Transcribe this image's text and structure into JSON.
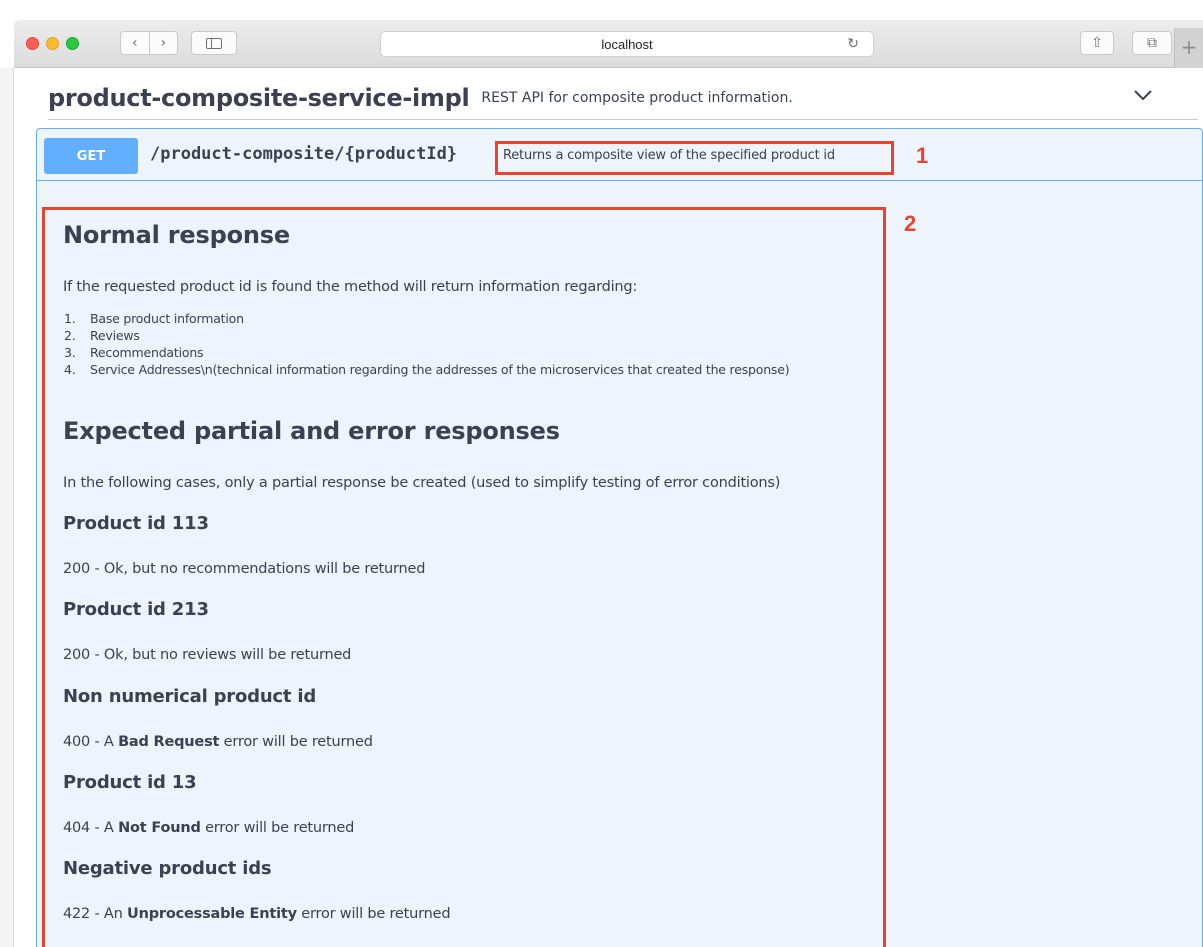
{
  "browser": {
    "address": "localhost",
    "nav_back": "‹",
    "nav_forward": "›",
    "reload": "↻",
    "share": "⇧",
    "tabs": "⧉",
    "new_tab": "+"
  },
  "api": {
    "title": "product-composite-service-impl",
    "description": "REST API for composite product information."
  },
  "operation": {
    "method": "GET",
    "path": "/product-composite/{productId}",
    "summary": "Returns a composite view of the specified product id"
  },
  "annotations": {
    "box1_label": "1",
    "box2_label": "2"
  },
  "doc": {
    "normal_heading": "Normal response",
    "normal_intro": "If the requested product id is found the method will return information regarding:",
    "normal_items": [
      {
        "num": "1.",
        "text": "Base product information"
      },
      {
        "num": "2.",
        "text": "Reviews"
      },
      {
        "num": "3.",
        "text": "Recommendations"
      },
      {
        "num": "4.",
        "text": "Service Addresses\\n(technical information regarding the addresses of the microservices that created the response)"
      }
    ],
    "partial_heading": "Expected partial and error responses",
    "partial_intro": "In the following cases, only a partial response be created (used to simplify testing of error conditions)",
    "cases": [
      {
        "heading": "Product id 113",
        "prefix": "200 - Ok, but no recommendations will be returned",
        "bold": "",
        "suffix": ""
      },
      {
        "heading": "Product id 213",
        "prefix": "200 - Ok, but no reviews will be returned",
        "bold": "",
        "suffix": ""
      },
      {
        "heading": "Non numerical product id",
        "prefix": "400 - A ",
        "bold": "Bad Request",
        "suffix": " error will be returned"
      },
      {
        "heading": "Product id 13",
        "prefix": "404 - A ",
        "bold": "Not Found",
        "suffix": " error will be returned"
      },
      {
        "heading": "Negative product ids",
        "prefix": "422 - An ",
        "bold": "Unprocessable Entity",
        "suffix": " error will be returned"
      }
    ]
  },
  "colors": {
    "get_method": "#61affe",
    "opblock_bg": "#eef4fb",
    "annotation": "#e8452f"
  }
}
